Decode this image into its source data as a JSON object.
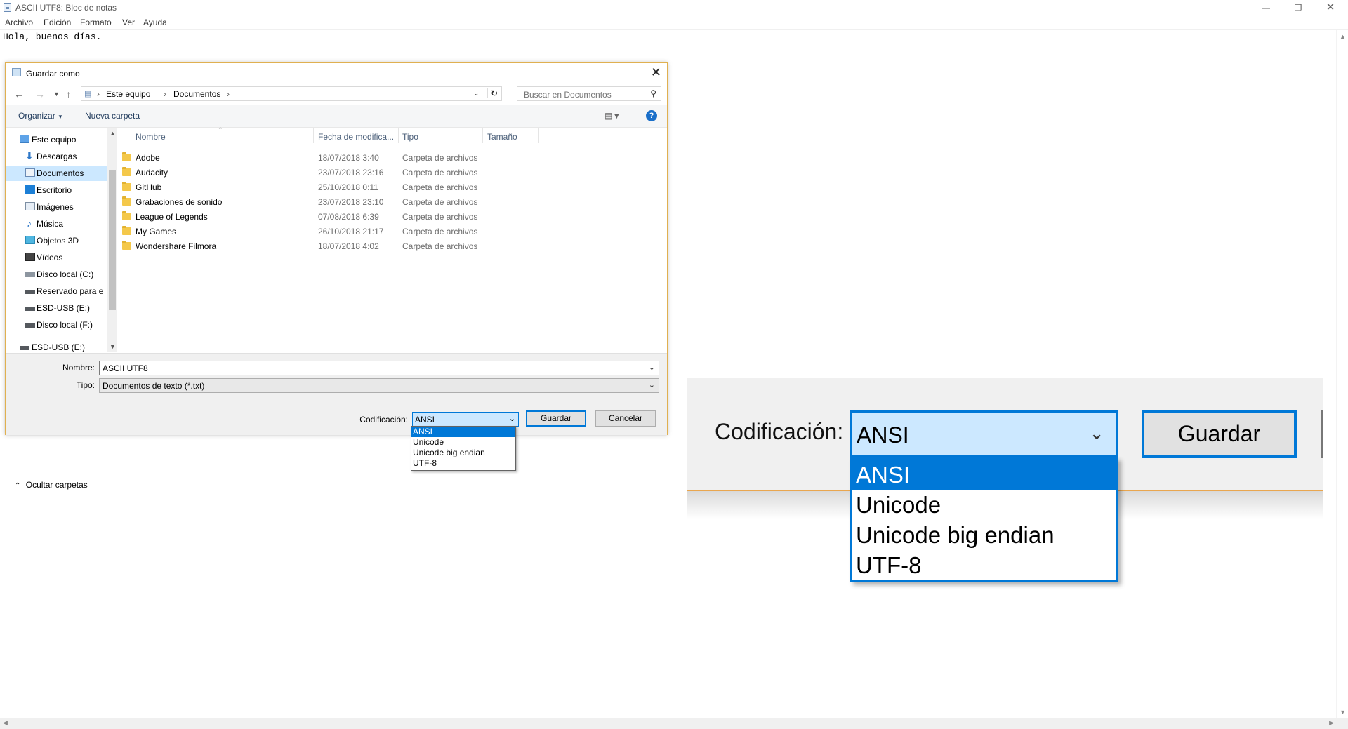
{
  "window": {
    "title": "ASCII UTF8: Bloc de notas",
    "menu": [
      "Archivo",
      "Edición",
      "Formato",
      "Ver",
      "Ayuda"
    ]
  },
  "editor": {
    "text": "Hola, buenos días."
  },
  "dialog": {
    "title": "Guardar como",
    "breadcrumb": [
      "Este equipo",
      "Documentos"
    ],
    "search_placeholder": "Buscar en Documentos",
    "toolbar": {
      "organize": "Organizar",
      "new_folder": "Nueva carpeta",
      "help": "?"
    },
    "nav_items": [
      "Este equipo",
      "Descargas",
      "Documentos",
      "Escritorio",
      "Imágenes",
      "Música",
      "Objetos 3D",
      "Vídeos",
      "Disco local (C:)",
      "Reservado para e",
      "ESD-USB (E:)",
      "Disco local (F:)",
      "ESD-USB (E:)"
    ],
    "columns": {
      "name": "Nombre",
      "date": "Fecha de modifica...",
      "type": "Tipo",
      "size": "Tamaño"
    },
    "files": [
      {
        "name": "Adobe",
        "date": "18/07/2018 3:40",
        "type": "Carpeta de archivos"
      },
      {
        "name": "Audacity",
        "date": "23/07/2018 23:16",
        "type": "Carpeta de archivos"
      },
      {
        "name": "GitHub",
        "date": "25/10/2018 0:11",
        "type": "Carpeta de archivos"
      },
      {
        "name": "Grabaciones de sonido",
        "date": "23/07/2018 23:10",
        "type": "Carpeta de archivos"
      },
      {
        "name": "League of Legends",
        "date": "07/08/2018 6:39",
        "type": "Carpeta de archivos"
      },
      {
        "name": "My Games",
        "date": "26/10/2018 21:17",
        "type": "Carpeta de archivos"
      },
      {
        "name": "Wondershare Filmora",
        "date": "18/07/2018 4:02",
        "type": "Carpeta de archivos"
      }
    ],
    "filename_label": "Nombre:",
    "filename_value": "ASCII UTF8",
    "type_label": "Tipo:",
    "type_value": "Documentos de texto (*.txt)",
    "encoding_label": "Codificación:",
    "encoding_value": "ANSI",
    "encoding_options": [
      "ANSI",
      "Unicode",
      "Unicode big endian",
      "UTF-8"
    ],
    "save_label": "Guardar",
    "cancel_label": "Cancelar",
    "hide_folders_label": "Ocultar carpetas"
  },
  "colors": {
    "accent": "#0078d7",
    "selection": "#cce8ff",
    "dialog_border": "#e0b050"
  }
}
